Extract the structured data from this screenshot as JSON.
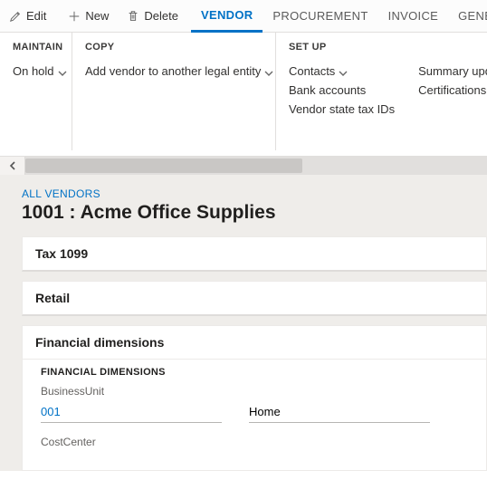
{
  "toolbar": {
    "edit": "Edit",
    "new": "New",
    "delete": "Delete"
  },
  "tabs": {
    "vendor": "VENDOR",
    "procurement": "PROCUREMENT",
    "invoice": "INVOICE",
    "general": "GENER"
  },
  "ribbon": {
    "maintain": {
      "head": "MAINTAIN",
      "onhold": "On hold"
    },
    "copy": {
      "head": "COPY",
      "addvendor": "Add vendor to another legal entity"
    },
    "setup": {
      "head": "SET UP",
      "contacts": "Contacts",
      "bank": "Bank accounts",
      "taxids": "Vendor state tax IDs",
      "summary": "Summary upd",
      "cert": "Certifications"
    }
  },
  "crumb": "ALL VENDORS",
  "title": "1001 : Acme Office Supplies",
  "fasttabs": {
    "tax1099": "Tax 1099",
    "retail": "Retail",
    "findim": "Financial dimensions"
  },
  "findim": {
    "section": "FINANCIAL DIMENSIONS",
    "businessunit_label": "BusinessUnit",
    "businessunit_value": "001",
    "businessunit_desc": "Home",
    "costcenter_label": "CostCenter"
  }
}
